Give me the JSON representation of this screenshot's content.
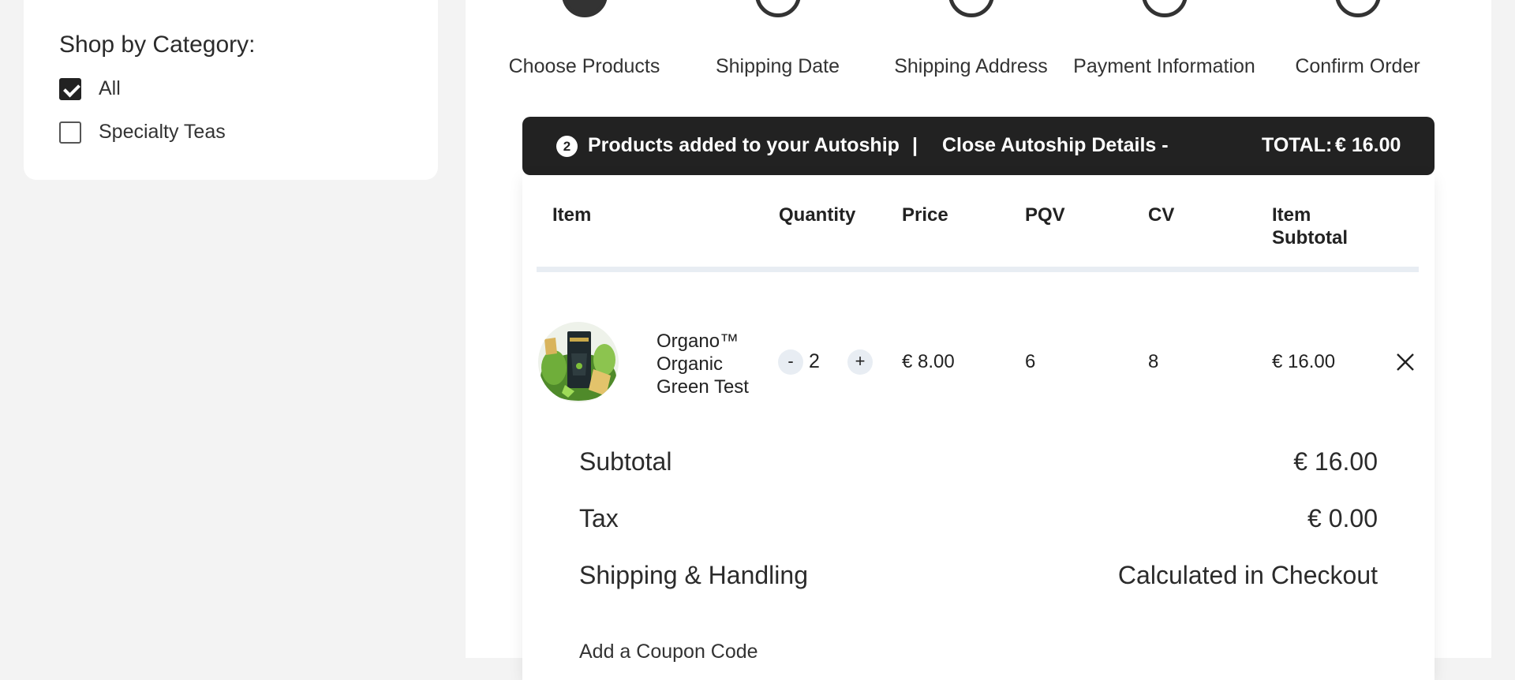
{
  "sidebar": {
    "title": "Shop by Category:",
    "categories": [
      {
        "label": "All",
        "checked": true
      },
      {
        "label": "Specialty Teas",
        "checked": false
      }
    ]
  },
  "steps": [
    {
      "label": "Choose Products",
      "active": true
    },
    {
      "label": "Shipping Date",
      "active": false
    },
    {
      "label": "Shipping Address",
      "active": false
    },
    {
      "label": "Payment Information",
      "active": false
    },
    {
      "label": "Confirm Order",
      "active": false
    }
  ],
  "autoship_bar": {
    "count": "2",
    "products_text": "Products added to your Autoship",
    "separator": "|",
    "close_text": "Close Autoship Details  -",
    "total_label": "TOTAL:",
    "total_value": "€ 16.00"
  },
  "table": {
    "headers": {
      "item": "Item",
      "quantity": "Quantity",
      "price": "Price",
      "pqv": "PQV",
      "cv": "CV",
      "subtotal_line1": "Item",
      "subtotal_line2": "Subtotal"
    },
    "rows": [
      {
        "name_lines": [
          "Organo™",
          "Organic",
          "Green Test"
        ],
        "minus": "-",
        "quantity": "2",
        "plus": "+",
        "price": "€ 8.00",
        "pqv": "6",
        "cv": "8",
        "subtotal": "€ 16.00"
      }
    ]
  },
  "summary": {
    "subtotal_label": "Subtotal",
    "subtotal_value": "€ 16.00",
    "tax_label": "Tax",
    "tax_value": "€ 0.00",
    "shipping_label": "Shipping & Handling",
    "shipping_value": "Calculated in Checkout"
  },
  "coupon": {
    "label": "Add a Coupon Code"
  },
  "icons": {
    "remove": "close-icon",
    "checkbox_checked": "checkmark-icon",
    "product": "product-image"
  }
}
